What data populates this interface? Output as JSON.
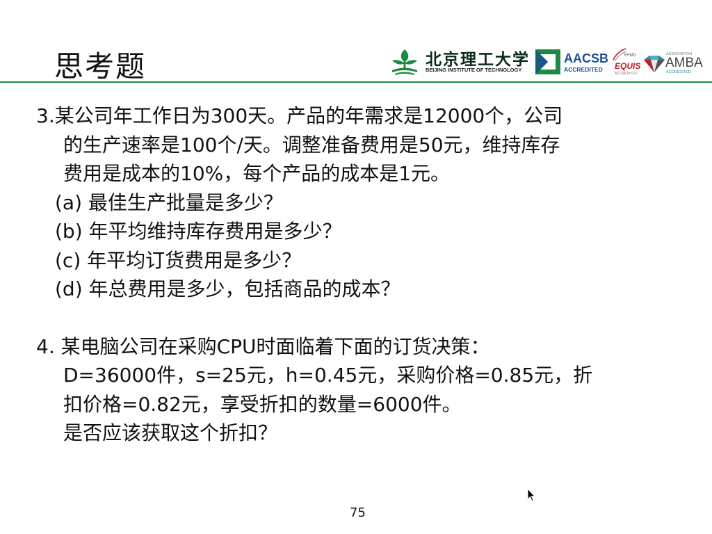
{
  "slide": {
    "title": "思考题",
    "page_number": "75"
  },
  "logos": {
    "bit_cn": "北京理工大学",
    "bit_en": "BEIJING INSTITUTE OF TECHNOLOGY",
    "aacsb_name": "AACSB",
    "aacsb_accredited": "ACCREDITED",
    "efmd_tag": "EFMD",
    "equis_name": "EQUIS",
    "equis_accredited": "ACCREDITED",
    "amba_association": "ASSOCIATION",
    "amba_name": "AMBA",
    "amba_accredited": "ACCREDITED",
    "colors": {
      "bit_green": "#1d8a43",
      "aacsb_blue": "#1f4f99",
      "equis_red": "#c0202a",
      "amba_teal": "#2a8a9a"
    }
  },
  "question3": {
    "line1": "3.某公司年工作日为300天。产品的年需求是12000个，公司",
    "line2": "的生产速率是100个/天。调整准备费用是50元，维持库存",
    "line3": "费用是成本的10%，每个产品的成本是1元。",
    "sub_items": [
      "(a) 最佳生产批量是多少？",
      "(b) 年平均维持库存费用是多少？",
      "(c) 年平均订货费用是多少？",
      "(d) 年总费用是多少，包括商品的成本？"
    ]
  },
  "question4": {
    "line1": "4. 某电脑公司在采购CPU时面临着下面的订货决策：",
    "line2": "D=36000件，s=25元，h=0.45元，采购价格=0.85元，折",
    "line3": "扣价格=0.82元，享受折扣的数量=6000件。",
    "line4": "是否应该获取这个折扣？"
  },
  "icons": {
    "cursor": "mouse-pointer-icon"
  }
}
